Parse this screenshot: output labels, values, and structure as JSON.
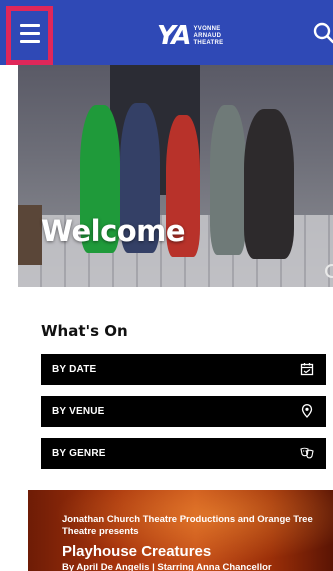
{
  "header": {
    "logo_mark": "YA",
    "logo_lines": [
      "YVONNE",
      "ARNAUD",
      "THEATRE"
    ],
    "colors": {
      "header_bg": "#2f49b6",
      "menu_highlight": "#e0275a"
    },
    "icons": {
      "menu": "hamburger-menu-icon",
      "search": "search-icon"
    }
  },
  "hero": {
    "heading": "Welcome"
  },
  "whats_on": {
    "title": "What's On",
    "filters": [
      {
        "label": "BY DATE",
        "icon": "calendar-icon"
      },
      {
        "label": "BY VENUE",
        "icon": "location-pin-icon"
      },
      {
        "label": "BY GENRE",
        "icon": "theatre-masks-icon"
      }
    ]
  },
  "featured_show": {
    "presenter": "Jonathan Church Theatre Productions and Orange Tree Theatre presents",
    "title": "Playhouse Creatures",
    "credits": "By April De Angelis | Starring Anna Chancellor"
  }
}
